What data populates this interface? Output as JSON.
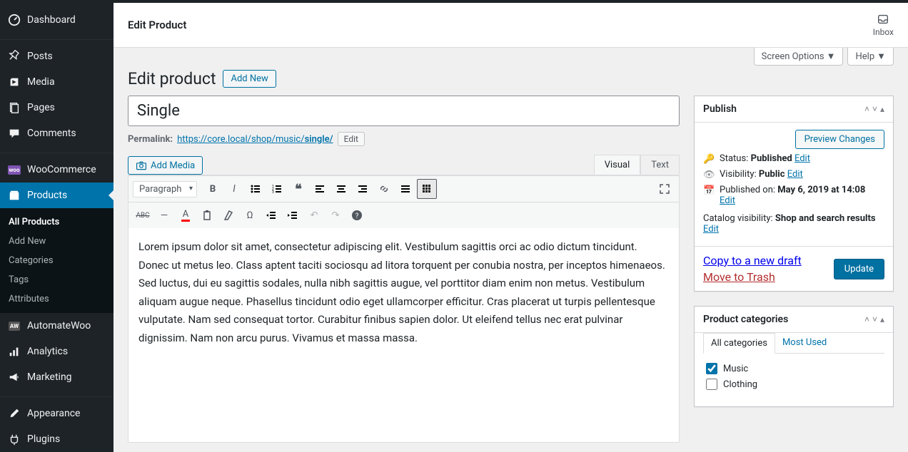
{
  "header": {
    "title": "Edit Product",
    "inbox": "Inbox"
  },
  "screen_options": "Screen Options",
  "help": "Help",
  "page_title": "Edit product",
  "add_new": "Add New",
  "product_title": "Single",
  "permalink": {
    "label": "Permalink:",
    "base": "https://core.local/shop/music/",
    "slug": "single/",
    "edit": "Edit"
  },
  "editor": {
    "add_media": "Add Media",
    "tab_visual": "Visual",
    "tab_text": "Text",
    "format_select": "Paragraph",
    "content": "Lorem ipsum dolor sit amet, consectetur adipiscing elit. Vestibulum sagittis orci ac odio dictum tincidunt. Donec ut metus leo. Class aptent taciti sociosqu ad litora torquent per conubia nostra, per inceptos himenaeos. Sed luctus, dui eu sagittis sodales, nulla nibh sagittis augue, vel porttitor diam enim non metus. Vestibulum aliquam augue neque. Phasellus tincidunt odio eget ullamcorper efficitur. Cras placerat ut turpis pellentesque vulputate. Nam sed consequat tortor. Curabitur finibus sapien dolor. Ut eleifend tellus nec erat pulvinar dignissim. Nam non arcu purus. Vivamus et massa massa."
  },
  "sidebar": {
    "items": [
      {
        "label": "Dashboard"
      },
      {
        "label": "Posts"
      },
      {
        "label": "Media"
      },
      {
        "label": "Pages"
      },
      {
        "label": "Comments"
      },
      {
        "label": "WooCommerce"
      },
      {
        "label": "Products"
      },
      {
        "label": "AutomateWoo"
      },
      {
        "label": "Analytics"
      },
      {
        "label": "Marketing"
      },
      {
        "label": "Appearance"
      },
      {
        "label": "Plugins"
      }
    ],
    "submenu": [
      {
        "label": "All Products"
      },
      {
        "label": "Add New"
      },
      {
        "label": "Categories"
      },
      {
        "label": "Tags"
      },
      {
        "label": "Attributes"
      }
    ]
  },
  "publish": {
    "title": "Publish",
    "preview": "Preview Changes",
    "status_label": "Status:",
    "status_value": "Published",
    "visibility_label": "Visibility:",
    "visibility_value": "Public",
    "published_label": "Published on:",
    "published_value": "May 6, 2019 at 14:08",
    "edit": "Edit",
    "catalog_label": "Catalog visibility:",
    "catalog_value": "Shop and search results",
    "copy_draft": "Copy to a new draft",
    "trash": "Move to Trash",
    "update": "Update"
  },
  "categories": {
    "title": "Product categories",
    "tab_all": "All categories",
    "tab_used": "Most Used",
    "items": [
      {
        "label": "Music",
        "checked": true
      },
      {
        "label": "Clothing",
        "checked": false
      }
    ]
  }
}
